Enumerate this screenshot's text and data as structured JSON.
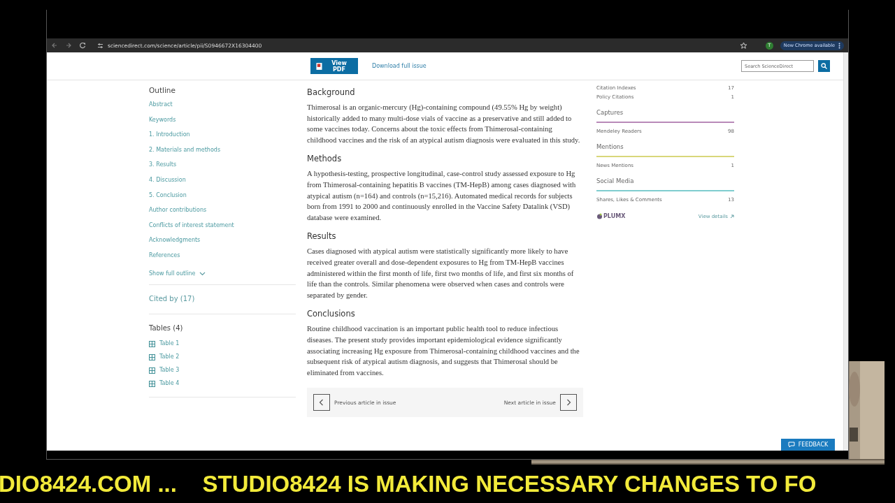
{
  "browser": {
    "url": "sciencedirect.com/science/article/pii/S0946672X16304400",
    "profile_initial": "T",
    "update_button": "New Chrome available"
  },
  "header": {
    "view_pdf": "View PDF",
    "download": "Download full issue",
    "search_placeholder": "Search ScienceDirect"
  },
  "outline": {
    "title": "Outline",
    "items": [
      "Abstract",
      "Keywords",
      "1. Introduction",
      "2. Materials and methods",
      "3. Results",
      "4. Discussion",
      "5. Conclusion",
      "Author contributions",
      "Conflicts of interest statement",
      "Acknowledgments",
      "References"
    ],
    "show_full": "Show full outline"
  },
  "cited_by": "Cited by (17)",
  "tables": {
    "title": "Tables (4)",
    "items": [
      "Table 1",
      "Table 2",
      "Table 3",
      "Table 4"
    ]
  },
  "abstract": [
    {
      "heading": "Background",
      "text": "Thimerosal is an organic-mercury (Hg)-containing compound (49.55% Hg by weight) historically added to many multi-dose vials of vaccine as a preservative and still added to some vaccines today. Concerns about the toxic effects from Thimerosal-containing childhood vaccines and the risk of an atypical autism diagnosis were evaluated in this study."
    },
    {
      "heading": "Methods",
      "text": "A hypothesis-testing, prospective longitudinal, case-control study assessed exposure to Hg from Thimerosal-containing hepatitis B vaccines (TM-HepB) among cases diagnosed with atypical autism (n=164) and controls (n=15,216). Automated medical records for subjects born from 1991 to 2000 and continuously enrolled in the Vaccine Safety Datalink (VSD) database were examined."
    },
    {
      "heading": "Results",
      "text": "Cases diagnosed with atypical autism were statistically significantly more likely to have received greater overall and dose-dependent exposures to Hg from TM-HepB vaccines administered within the first month of life, first two months of life, and first six months of life than the controls. Similar phenomena were observed when cases and controls were separated by gender."
    },
    {
      "heading": "Conclusions",
      "text": "Routine childhood vaccination is an important public health tool to reduce infectious diseases. The present study provides important epidemiological evidence significantly associating increasing Hg exposure from Thimerosal-containing childhood vaccines and the subsequent risk of atypical autism diagnosis, and suggests that Thimerosal should be eliminated from vaccines."
    }
  ],
  "article_nav": {
    "previous": "Previous article in issue",
    "next": "Next article in issue"
  },
  "metrics": {
    "rows": [
      {
        "label": "Citation Indexes",
        "value": "17"
      },
      {
        "label": "Policy Citations",
        "value": "1"
      }
    ],
    "groups": [
      {
        "title": "Captures",
        "color": "#b98ab9",
        "rows": [
          {
            "label": "Mendeley Readers",
            "value": "98"
          }
        ]
      },
      {
        "title": "Mentions",
        "color": "#d8d77a",
        "rows": [
          {
            "label": "News Mentions",
            "value": "1"
          }
        ]
      },
      {
        "title": "Social Media",
        "color": "#7fcdcf",
        "rows": [
          {
            "label": "Shares, Likes & Comments",
            "value": "13"
          }
        ]
      }
    ],
    "logo": "PLUMX",
    "view_details": "View details"
  },
  "feedback": "FEEDBACK",
  "ticker": "DIO8424.COM ...    STUDIO8424 IS MAKING NECESSARY CHANGES TO FO"
}
